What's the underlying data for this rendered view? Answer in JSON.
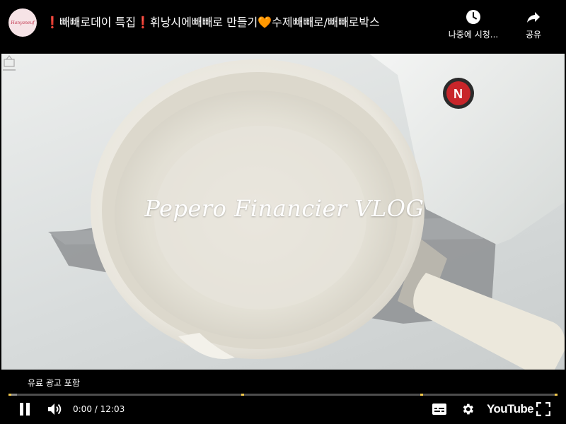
{
  "header": {
    "title": "❗빼빼로데이 특집❗휘낭시에빼빼로 만들기🧡수제빼빼로/빼빼로박스",
    "channel_avatar_text": "Hanyaneuf",
    "watch_later_label": "나중에 시청...",
    "share_label": "공유",
    "icons": {
      "watch_later": "clock-icon",
      "share": "share-arrow-icon"
    }
  },
  "video": {
    "overlay_text": "Pepero Financier VLOG",
    "pan_label_text": "N"
  },
  "player": {
    "paid_promotion_label": "유료 광고 포함",
    "current_time": "0:00",
    "time_separator": "/",
    "duration": "12:03",
    "progress_fraction": 0.015,
    "ad_markers": [
      0.0,
      0.424,
      0.75,
      1.0
    ],
    "youtube_logo_text": "YouTube",
    "icons": {
      "play_pause": "pause-icon",
      "volume": "volume-icon",
      "subtitles": "subtitles-icon",
      "settings": "gear-icon",
      "fullscreen": "fullscreen-icon"
    },
    "colors": {
      "ad_marker": "#f2c84b",
      "progress_track": "#4d4d4d"
    }
  }
}
